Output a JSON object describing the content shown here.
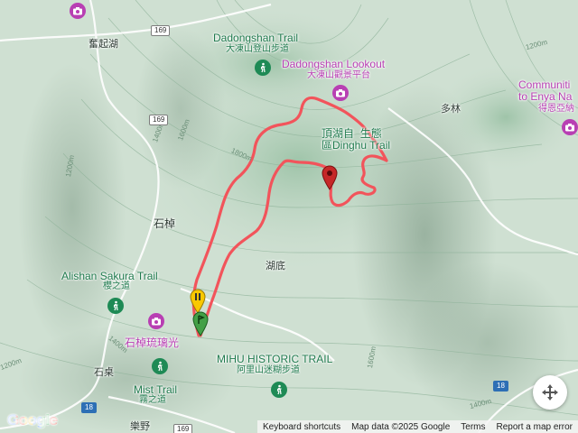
{
  "map": {
    "places": {
      "fenqihu": "奮起湖",
      "shizhuo": "石棹",
      "hudi": "湖底",
      "duolin": "多林",
      "shiquan": "石桌",
      "leye": "樂野"
    },
    "pois": {
      "dadongshan_trail_en": "Dadongshan Trail",
      "dadongshan_trail_zh": "大凍山登山步道",
      "dadongshan_lookout_en": "Dadongshan Lookout",
      "dadongshan_lookout_zh": "大凍山觀景平台",
      "dinghu_en_1": "頂湖自",
      "dinghu_en_2": "生態",
      "dinghu_en_3": "區Dinghu Trail",
      "community_en_1": "Communiti",
      "community_en_2": "to Enya Na",
      "community_zh": "得恩亞納",
      "sakura_en": "Alishan Sakura Trail",
      "sakura_zh": "櫻之道",
      "glass_zh": "石棹琉璃光",
      "mihu_en": "MIHU HISTORIC TRAIL",
      "mihu_zh": "阿里山迷糊步道",
      "mist_en": "Mist Trail",
      "mist_zh": "霧之道"
    },
    "roads": {
      "r169_a": "169",
      "r169_b": "169",
      "r169_c": "169",
      "r18_a": "18",
      "r18_b": "18"
    },
    "contours": {
      "c1200_a": "1200m",
      "c1400_a": "1400m",
      "c1600_a": "1600m",
      "c1800_a": "1800m",
      "c1200_b": "1200m",
      "c1400_b": "1400m",
      "c1600_b": "1600m",
      "c1200_c": "1200m",
      "c1400_c": "1400m"
    },
    "colors": {
      "track": "#f2545b",
      "green_poi": "#1e8a55",
      "pink_poi": "#b83fb3",
      "marker_end": "#c62828",
      "marker_start": "#43a047",
      "marker_pause": "#f9c800"
    }
  },
  "footer": {
    "logo": "Google",
    "shortcuts": "Keyboard shortcuts",
    "map_data": "Map data ©2025 Google",
    "terms": "Terms",
    "report": "Report a map error"
  }
}
